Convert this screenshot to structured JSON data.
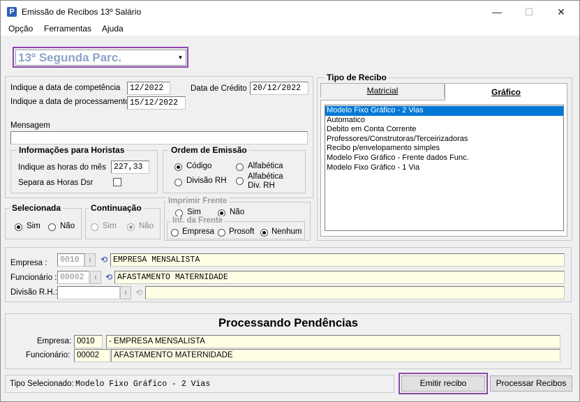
{
  "window": {
    "title": "Emissão de Recibos 13º Salário",
    "app_icon": "P"
  },
  "menu": [
    "Opção",
    "Ferramentas",
    "Ajuda"
  ],
  "parcel_select": {
    "value": "13º Segunda Parc.",
    "color": "#8aa4c8"
  },
  "dates": {
    "competencia_label": "Indique a data de competência",
    "competencia_value": "12/2022",
    "processamento_label": "Indique a data de processamento",
    "processamento_value": "15/12/2022",
    "credito_label": "Data de Crédito",
    "credito_value": "20/12/2022"
  },
  "mensagem": {
    "label": "Mensagem",
    "value": ""
  },
  "horistas": {
    "title": "Informações para Horistas",
    "horas_label": "Indique as horas do mês",
    "horas_value": "227,33",
    "separa_label": "Separa as Horas Dsr"
  },
  "ordem": {
    "title": "Ordem de Emissão",
    "codigo": "Código",
    "alfabetica": "Alfabética",
    "divisao_rh": "Divisão RH",
    "alfabetica_div_line1": "Alfabética",
    "alfabetica_div_line2": "Div. RH"
  },
  "selecionada": {
    "title": "Selecionada",
    "sim": "Sim",
    "nao": "Não"
  },
  "continuacao": {
    "title": "Continuação",
    "sim": "Sim",
    "nao": "Não"
  },
  "imprimir_frente": {
    "title": "Imprimir Frente",
    "sim": "Sim",
    "nao": "Não"
  },
  "inf_frente": {
    "title": "Inf. da Frente",
    "empresa": "Empresa",
    "prosoft": "Prosoft",
    "nenhum": "Nenhum"
  },
  "tipo_recibo": {
    "title": "Tipo de Recibo",
    "tabs": [
      "Matricial",
      "Gráfico"
    ],
    "items": [
      "Modelo Fixo Gráfico - 2 Vias",
      "Automatico",
      "Debito em Conta Corrente",
      "Professores/Construtoras/Terceirizadoras",
      "Recibo p/envelopamento simples",
      "Modelo Fixo Gráfico - Frente dados Func.",
      "Modelo Fixo Gráfico - 1 Via"
    ]
  },
  "lookup": {
    "empresa_label": "Empresa :",
    "empresa_code": "0010",
    "empresa_name": "EMPRESA MENSALISTA",
    "funcionario_label": "Funcionário :",
    "funcionario_code": "00002",
    "funcionario_name": "AFASTAMENTO MATERNIDADE",
    "divisao_label": "Divisão R.H.:",
    "divisao_code": "",
    "divisao_name": ""
  },
  "pendencias": {
    "title": "Processando Pendências",
    "empresa_label": "Empresa:",
    "empresa_code": "0010",
    "empresa_name": "- EMPRESA MENSALISTA",
    "funcionario_label": "Funcionário:",
    "funcionario_code": "00002",
    "funcionario_name": "AFASTAMENTO MATERNIDADE"
  },
  "status": {
    "label": "Tipo Selecionado:",
    "value": "Modelo Fixo Gráfico - 2 Vias"
  },
  "buttons": {
    "emitir": "Emitir recibo",
    "processar": "Processar Recibos"
  },
  "colors": {
    "highlight": "#8e44ad",
    "selection": "#0078d7",
    "field_yellow": "#ffffe6"
  }
}
